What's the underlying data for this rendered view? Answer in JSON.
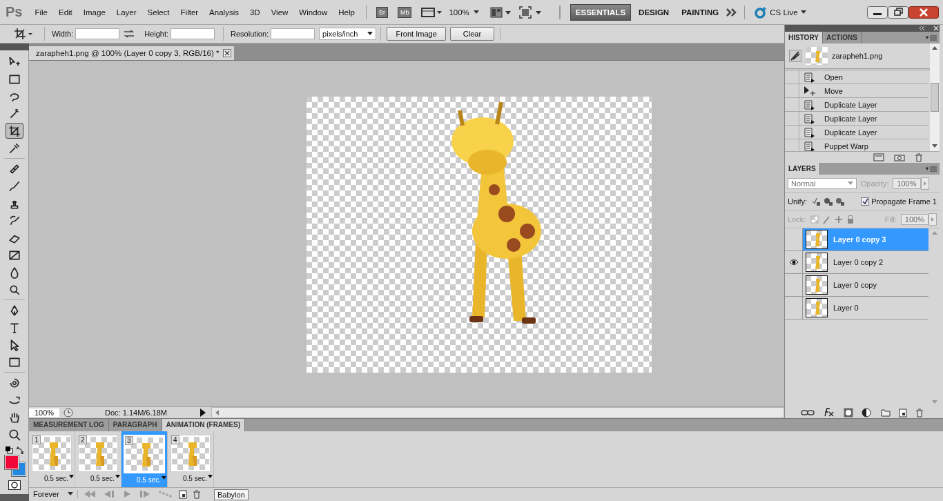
{
  "menu_bar": {
    "logo": "Ps",
    "items": [
      "File",
      "Edit",
      "Image",
      "Layer",
      "Select",
      "Filter",
      "Analysis",
      "3D",
      "View",
      "Window",
      "Help"
    ],
    "bridge": "Br",
    "mini_bridge": "Mb",
    "zoom": "100%",
    "workspaces": [
      {
        "label": "ESSENTIALS",
        "selected": true
      },
      {
        "label": "DESIGN",
        "selected": false
      },
      {
        "label": "PAINTING",
        "selected": false
      }
    ],
    "cs_live": "CS Live"
  },
  "options_bar": {
    "width_label": "Width:",
    "height_label": "Height:",
    "resolution_label": "Resolution:",
    "units": "pixels/inch",
    "buttons": [
      "Front Image",
      "Clear"
    ]
  },
  "document_tab": {
    "title": "zarapheh1.png @ 100% (Layer 0 copy 3, RGB/16) *"
  },
  "tools": [
    {
      "selected": false
    },
    {
      "selected": false
    },
    {
      "selected": false
    },
    {
      "selected": false
    },
    {
      "selected": true
    },
    {
      "selected": false
    },
    {
      "selected": false
    },
    {
      "selected": false
    },
    {
      "selected": false
    },
    {
      "selected": false
    },
    {
      "selected": false
    },
    {
      "selected": false
    },
    {
      "selected": false
    },
    {
      "selected": false
    },
    {
      "selected": false
    },
    {
      "selected": false
    },
    {
      "selected": false
    },
    {
      "selected": false
    },
    {
      "selected": false
    },
    {
      "selected": false
    },
    {
      "selected": false
    },
    {
      "selected": false
    }
  ],
  "swatches": [
    {
      "kind": "foreground",
      "color": "#f2073b"
    },
    {
      "kind": "background",
      "color": "#2288e0"
    }
  ],
  "status_bar": {
    "zoom": "100%",
    "doc": "Doc: 1.14M/6.18M"
  },
  "history": {
    "tabs": [
      {
        "label": "HISTORY",
        "selected": true
      },
      {
        "label": "ACTIONS",
        "selected": false
      }
    ],
    "snapshot": "zarapheh1.png",
    "steps": [
      {
        "kind": "command",
        "label": "Open"
      },
      {
        "kind": "move",
        "label": "Move"
      },
      {
        "kind": "command",
        "label": "Duplicate Layer"
      },
      {
        "kind": "command",
        "label": "Duplicate Layer"
      },
      {
        "kind": "command",
        "label": "Duplicate Layer"
      },
      {
        "kind": "command",
        "label": "Puppet Warp"
      }
    ]
  },
  "layers": {
    "tab": "LAYERS",
    "blend_mode": "Normal",
    "opacity_label": "Opacity:",
    "opacity": "100%",
    "unify_label": "Unify:",
    "propagate": {
      "label": "Propagate Frame 1",
      "checked": true
    },
    "lock_label": "Lock:",
    "fill_label": "Fill:",
    "fill": "100%",
    "items": [
      {
        "name": "Layer 0 copy 3",
        "selected": true,
        "visible": false
      },
      {
        "name": "Layer 0 copy 2",
        "selected": false,
        "visible": true
      },
      {
        "name": "Layer 0 copy",
        "selected": false,
        "visible": false
      },
      {
        "name": "Layer 0",
        "selected": false,
        "visible": false
      }
    ]
  },
  "animation": {
    "tabs": [
      {
        "label": "MEASUREMENT LOG",
        "selected": false
      },
      {
        "label": "PARAGRAPH",
        "selected": false
      },
      {
        "label": "ANIMATION (FRAMES)",
        "selected": true
      }
    ],
    "frames": [
      {
        "number": "1",
        "delay": "0.5 sec.",
        "selected": false
      },
      {
        "number": "2",
        "delay": "0.5 sec.",
        "selected": false
      },
      {
        "number": "3",
        "delay": "0.5 sec.",
        "selected": true
      },
      {
        "number": "4",
        "delay": "0.5 sec.",
        "selected": false
      }
    ],
    "loop": "Forever",
    "tooltip": "Babylon"
  }
}
